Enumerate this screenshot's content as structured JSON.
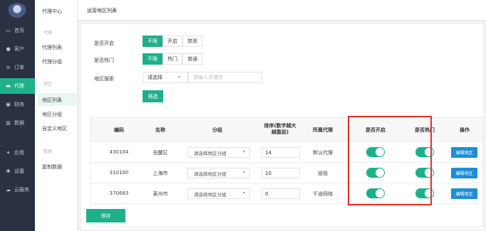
{
  "sidebar": {
    "items": [
      {
        "label": "首页",
        "icon": "monitor-icon"
      },
      {
        "label": "客户",
        "icon": "user-icon"
      },
      {
        "label": "订单",
        "icon": "list-icon"
      },
      {
        "label": "代理",
        "icon": "book-icon"
      },
      {
        "label": "财务",
        "icon": "money-icon"
      },
      {
        "label": "数据",
        "icon": "chart-icon"
      },
      {
        "label": "应用",
        "icon": "apps-icon"
      },
      {
        "label": "设置",
        "icon": "gear-icon"
      },
      {
        "label": "云服务",
        "icon": "cloud-icon"
      }
    ],
    "active_color": "#20b08a"
  },
  "subnav": {
    "title": "代理中心",
    "group1": "代理",
    "item1": "代理列表",
    "item2": "代理分组",
    "group2": "地区",
    "item3": "地区列表",
    "item4": "地区分组",
    "item5": "自定义地区",
    "group3": "数据",
    "item6": "复制数据"
  },
  "header": {
    "title": "运营地区列表"
  },
  "filters": {
    "open_label": "是否开启",
    "open_options": [
      "不限",
      "开启",
      "禁用"
    ],
    "hot_label": "是否热门",
    "hot_options": [
      "不限",
      "热门",
      "普通"
    ],
    "search_label": "地区搜索",
    "search_select": "请选择",
    "search_placeholder": "请输入关键字",
    "filter_button": "筛选"
  },
  "table": {
    "headers": {
      "code": "编码",
      "name": "名称",
      "group": "分组",
      "sort_line1": "排序(数字越大",
      "sort_line2": "越靠前)",
      "agent": "所属代理",
      "open": "是否开启",
      "hot": "是否热门",
      "ops": "操作"
    },
    "rows": [
      {
        "code": "430104",
        "name": "岳麓区",
        "group": "请选择地区分组",
        "sort": "14",
        "agent": "默认代理",
        "open": true,
        "hot": true,
        "edit": "编辑地区"
      },
      {
        "code": "310100",
        "name": "上海市",
        "group": "请选择地区分组",
        "sort": "10",
        "agent": "迪祖",
        "open": true,
        "hot": true,
        "edit": "编辑地区"
      },
      {
        "code": "370683",
        "name": "莱州市",
        "group": "请选择地区分组",
        "sort": "0",
        "agent": "千途网络",
        "open": true,
        "hot": true,
        "edit": "编辑地区"
      }
    ]
  },
  "save_button": "保存",
  "colors": {
    "accent": "#1fb08a",
    "edit": "#1e8fd6",
    "highlight": "#e0302a",
    "sidebar": "#2a3142"
  }
}
